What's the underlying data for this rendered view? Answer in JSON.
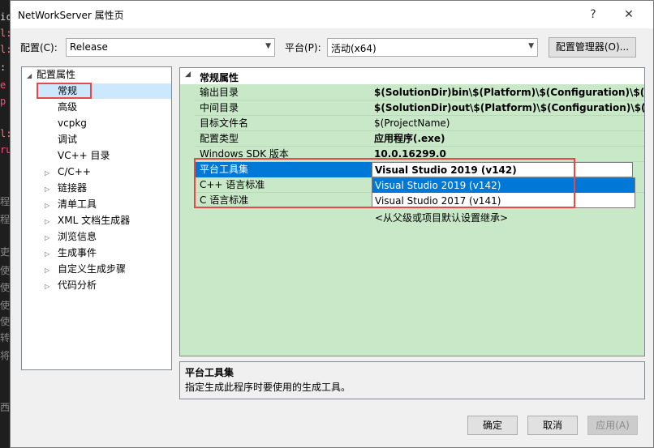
{
  "background_editor": {
    "lines": [
      "ic",
      "l:",
      "l:",
      ": ",
      "e",
      "p",
      "l:",
      "ru",
      "程",
      "程",
      "吏",
      "使",
      "使",
      "使",
      "使",
      "转",
      "将",
      "西"
    ]
  },
  "window": {
    "title": "NetWorkServer 属性页",
    "help_label": "?",
    "close_label": "✕"
  },
  "config_bar": {
    "config_label": "配置(C):",
    "config_value": "Release",
    "platform_label": "平台(P):",
    "platform_value": "活动(x64)",
    "manager_button": "配置管理器(O)..."
  },
  "tree": {
    "root": {
      "arrow": "◢",
      "label": "配置属性"
    },
    "items": [
      {
        "label": "常规",
        "expandable": false,
        "selected": true
      },
      {
        "label": "高级",
        "expandable": false
      },
      {
        "label": "vcpkg",
        "expandable": false
      },
      {
        "label": "调试",
        "expandable": false
      },
      {
        "label": "VC++ 目录",
        "expandable": false
      },
      {
        "label": "C/C++",
        "expandable": true
      },
      {
        "label": "链接器",
        "expandable": true
      },
      {
        "label": "清单工具",
        "expandable": true
      },
      {
        "label": "XML 文档生成器",
        "expandable": true
      },
      {
        "label": "浏览信息",
        "expandable": true
      },
      {
        "label": "生成事件",
        "expandable": true
      },
      {
        "label": "自定义生成步骤",
        "expandable": true
      },
      {
        "label": "代码分析",
        "expandable": true
      }
    ],
    "expand_glyph": "▷"
  },
  "property_grid": {
    "section_toggle": "◢",
    "section_title": "常规属性",
    "rows": [
      {
        "name": "输出目录",
        "value": "$(SolutionDir)bin\\$(Platform)\\$(Configuration)\\$(pr",
        "bold": true
      },
      {
        "name": "中间目录",
        "value": "$(SolutionDir)out\\$(Platform)\\$(Configuration)\\$(pr",
        "bold": true
      },
      {
        "name": "目标文件名",
        "value": "$(ProjectName)",
        "bold": false
      },
      {
        "name": "配置类型",
        "value": "应用程序(.exe)",
        "bold": true
      },
      {
        "name": "Windows SDK 版本",
        "value": "10.0.16299.0",
        "bold": true
      },
      {
        "name": "平台工具集",
        "value": "Visual Studio 2019 (v142)",
        "bold": true,
        "selected": true
      },
      {
        "name": "C++ 语言标准",
        "value": "",
        "bold": false
      },
      {
        "name": "C 语言标准",
        "value": "",
        "bold": false
      }
    ],
    "dropdown_arrow": "▼",
    "dropdown_options": [
      {
        "label": "Visual Studio 2019 (v142)",
        "highlighted": true
      },
      {
        "label": "Visual Studio 2017 (v141)",
        "highlighted": false
      }
    ],
    "inherit_option": "<从父级或项目默认设置继承>"
  },
  "description": {
    "title": "平台工具集",
    "text": "指定生成此程序时要使用的生成工具。"
  },
  "buttons": {
    "ok": "确定",
    "cancel": "取消",
    "apply": "应用(A)"
  },
  "colors": {
    "grid_bg": "#c8e8c8",
    "selection": "#0078d7",
    "highlight_box": "#e84848",
    "tree_selected": "#cce8ff"
  }
}
